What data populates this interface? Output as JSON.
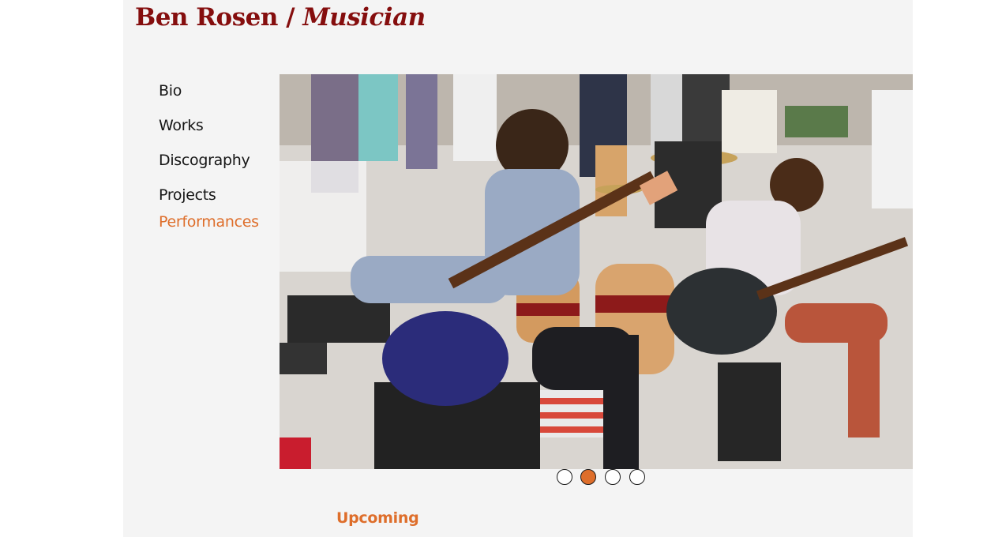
{
  "header": {
    "name": "Ben Rosen",
    "separator": "/",
    "role": "Musician"
  },
  "nav": {
    "items": [
      {
        "label": "Bio",
        "active": false
      },
      {
        "label": "Works",
        "active": false
      },
      {
        "label": "Discography",
        "active": false
      },
      {
        "label": "Projects",
        "active": false
      },
      {
        "label": "Performances",
        "active": true
      }
    ]
  },
  "slider": {
    "image_description": "two-musicians-playing-guitars-at-outdoor-event",
    "slide_count": 4,
    "current_slide": 2
  },
  "content": {
    "section_heading": "Upcoming"
  },
  "colors": {
    "title": "#850e0e",
    "accent": "#de6e2b",
    "page_background": "#f4f4f4",
    "nav_text": "#161616"
  }
}
